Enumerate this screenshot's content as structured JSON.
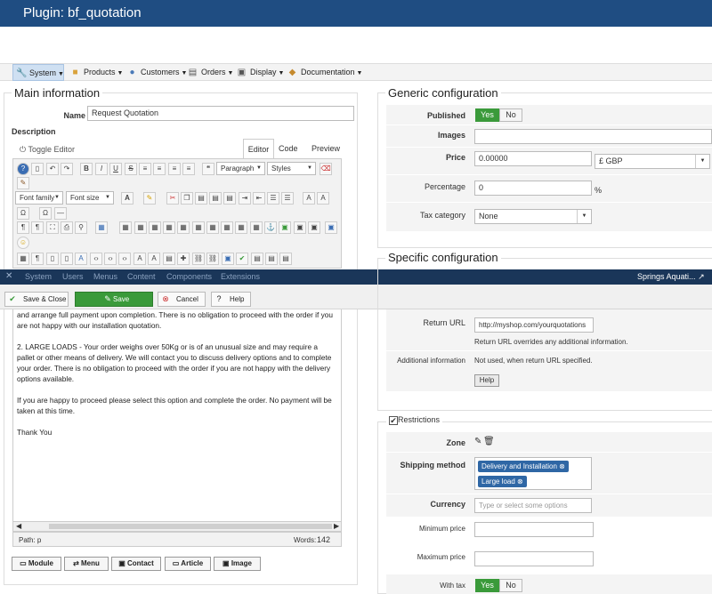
{
  "header": {
    "title": "Plugin: bf_quotation"
  },
  "menu": {
    "items": [
      "System",
      "Products",
      "Customers",
      "Orders",
      "Display",
      "Documentation"
    ]
  },
  "main_info": {
    "title": "Main information",
    "name_label": "Name",
    "name_value": "Request Quotation",
    "description_label": "Description",
    "toggle_editor": "Toggle Editor",
    "tabs": [
      "Editor",
      "Code",
      "Preview"
    ],
    "format_select": "Paragraph",
    "styles_select": "Styles",
    "font_family": "Font family",
    "font_size": "Font size",
    "body_paragraphs": [
      "and arrange full payment upon completion. There is no obligation to proceed with the order if you are not happy with our installation quotation.",
      "2. LARGE LOADS - Your order weighs over 50Kg or is of an unusual size and may require a pallet or other means of delivery. We will contact you to discuss delivery options and to complete your order. There is no obligation to proceed with the order if you are not happy with the delivery options available.",
      "If you are happy to proceed please select this option and complete the order. No payment will be taken at this time.",
      "Thank You"
    ],
    "path_label": "Path: p",
    "words_label": "Words:",
    "words_count": "142",
    "bottom_buttons": [
      "Module",
      "Menu",
      "Contact",
      "Article",
      "Image"
    ]
  },
  "generic": {
    "title": "Generic configuration",
    "published_label": "Published",
    "yes": "Yes",
    "no": "No",
    "images_label": "Images",
    "price_label": "Price",
    "price_value": "0.00000",
    "currency_value": "£ GBP",
    "percentage_label": "Percentage",
    "percentage_value": "0",
    "percent_sign": "%",
    "tax_label": "Tax category",
    "tax_value": "None"
  },
  "specific": {
    "title": "Specific configuration",
    "return_url_label": "Return URL",
    "return_url_value": "http://myshop.com/yourquotations",
    "return_note": "Return URL overrides any additional information.",
    "additional_label": "Additional information",
    "additional_value": "Not used, when return URL specified.",
    "help": "Help"
  },
  "restrictions": {
    "title": "Restrictions",
    "zone_label": "Zone",
    "shipping_label": "Shipping method",
    "shipping_tags": [
      "Delivery and Installation",
      "Large load"
    ],
    "currency_label": "Currency",
    "currency_placeholder": "Type or select some options",
    "min_label": "Minimum price",
    "max_label": "Maximum price",
    "with_tax_label": "With tax",
    "yes": "Yes",
    "no": "No"
  },
  "joomla_bar": {
    "items": [
      "System",
      "Users",
      "Menus",
      "Content",
      "Components",
      "Extensions"
    ],
    "site": "Springs Aquati..."
  },
  "toolbar": {
    "save_close": "Save & Close",
    "save": "Save",
    "cancel": "Cancel",
    "help": "Help"
  },
  "colors": {
    "header": "#1f4d82",
    "joomla_bar": "#1a3659",
    "save": "#3a9a3a",
    "tag": "#2f67a5"
  }
}
